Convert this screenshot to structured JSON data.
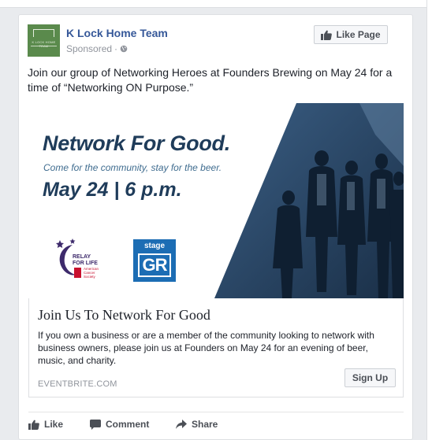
{
  "post": {
    "page_name": "K Lock Home Team",
    "sponsored_label": "Sponsored",
    "separator": "·",
    "like_page_label": "Like Page",
    "body_text": "Join our group of Networking Heroes at Founders Brewing on May 24 for a time of “Networking ON Purpose.”",
    "avatar_text": "K LOCK HOME TEAM"
  },
  "ad_image": {
    "headline": "Network For Good.",
    "tagline": "Come for the community, stay for the beer.",
    "date_time": "May 24 | 6 p.m.",
    "relay_logo_text": "RELAY\nFOR LIFE",
    "acs_text": "American\nCancer\nSociety",
    "stage_logo_text": "stage",
    "stage_logo_mark": "GR"
  },
  "link": {
    "title": "Join Us To Network For Good",
    "description": "If you own a business or are a member of the community looking to network with business owners, please join us at Founders on May 24 for an evening of beer, music, and charity.",
    "domain": "EVENTBRITE.COM",
    "cta_label": "Sign Up"
  },
  "actions": {
    "like": "Like",
    "comment": "Comment",
    "share": "Share"
  },
  "icons": {
    "globe": "globe-icon",
    "thumb": "thumbs-up-icon",
    "comment": "comment-bubble-icon",
    "share": "share-arrow-icon"
  },
  "colors": {
    "link_blue": "#365899",
    "headline_navy": "#1f3c5a",
    "stage_blue": "#1c6db4",
    "relay_purple": "#3d2a6b",
    "acs_red": "#c8102e"
  }
}
